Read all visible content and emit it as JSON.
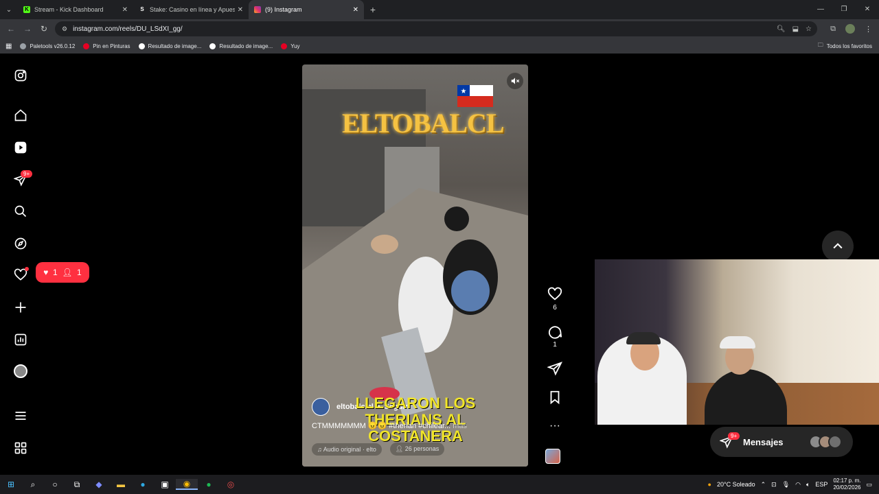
{
  "browser": {
    "tabs": [
      {
        "title": "Stream - Kick Dashboard",
        "icon": "kick-icon",
        "color": "#53fc18",
        "active": false
      },
      {
        "title": "Stake: Casino en línea y Apuest",
        "icon": "stake-icon",
        "color": "#e8eaed",
        "active": false
      },
      {
        "title": "(9) Instagram",
        "icon": "instagram-icon",
        "color": "#e1306c",
        "active": true
      }
    ],
    "url": "instagram.com/reels/DU_LSdXI_gg/",
    "bookmarks": [
      {
        "label": "Paletools v26.0.12",
        "icon": "globe-icon"
      },
      {
        "label": "Pin en Pinturas",
        "icon": "pinterest-icon"
      },
      {
        "label": "Resultado de image...",
        "icon": "google-icon"
      },
      {
        "label": "Resultado de image...",
        "icon": "google-icon"
      },
      {
        "label": "Yuy",
        "icon": "pinterest-icon"
      }
    ],
    "all_bookmarks": "Todos los favoritos"
  },
  "sidebar": {
    "notifications_badge": "9+",
    "activity_pill": {
      "likes": "1",
      "follows": "1"
    }
  },
  "reel": {
    "overlay_logo": "ELTOBALCL",
    "caption_overlay": "LLEGARON LOS THERIANS AL COSTANERA",
    "author": "eltobalclcl",
    "follow": "Seguir",
    "description": "CTMMMMMMM 😠😠 #therian #chilear...",
    "more": "más",
    "audio": "Audio original",
    "audio_author": "elto",
    "people": "26 personas",
    "likes": "6",
    "comments": "1"
  },
  "messages": {
    "label": "Mensajes",
    "badge": "9+"
  },
  "taskbar": {
    "weather": "20°C  Soleado",
    "lang": "ESP",
    "time": "02:17 p. m.",
    "date": "20/02/2026"
  },
  "colors": {
    "accent_red": "#ff3040",
    "page_bg": "#000000",
    "chrome_dark": "#35363a"
  }
}
